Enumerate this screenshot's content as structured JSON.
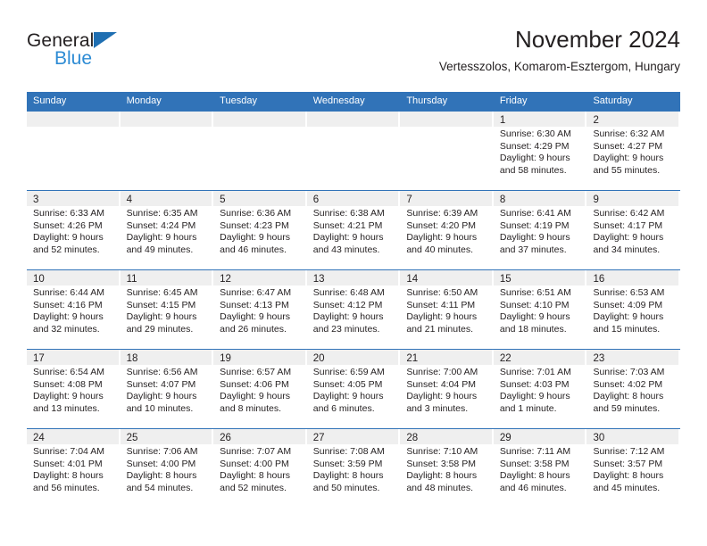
{
  "brand": {
    "name_top": "General",
    "name_bottom": "Blue",
    "triangle_color": "#1f6fb2",
    "blue_text_color": "#2d8bd4"
  },
  "header": {
    "title": "November 2024",
    "subtitle": "Vertesszolos, Komarom-Esztergom, Hungary"
  },
  "theme": {
    "header_blue": "#3173b8",
    "day_band_gray": "#efefef",
    "text_color": "#231f20"
  },
  "weekday_headers": [
    "Sunday",
    "Monday",
    "Tuesday",
    "Wednesday",
    "Thursday",
    "Friday",
    "Saturday"
  ],
  "weeks": [
    [
      {
        "day": "",
        "lines": []
      },
      {
        "day": "",
        "lines": []
      },
      {
        "day": "",
        "lines": []
      },
      {
        "day": "",
        "lines": []
      },
      {
        "day": "",
        "lines": []
      },
      {
        "day": "1",
        "lines": [
          "Sunrise: 6:30 AM",
          "Sunset: 4:29 PM",
          "Daylight: 9 hours",
          "and 58 minutes."
        ]
      },
      {
        "day": "2",
        "lines": [
          "Sunrise: 6:32 AM",
          "Sunset: 4:27 PM",
          "Daylight: 9 hours",
          "and 55 minutes."
        ]
      }
    ],
    [
      {
        "day": "3",
        "lines": [
          "Sunrise: 6:33 AM",
          "Sunset: 4:26 PM",
          "Daylight: 9 hours",
          "and 52 minutes."
        ]
      },
      {
        "day": "4",
        "lines": [
          "Sunrise: 6:35 AM",
          "Sunset: 4:24 PM",
          "Daylight: 9 hours",
          "and 49 minutes."
        ]
      },
      {
        "day": "5",
        "lines": [
          "Sunrise: 6:36 AM",
          "Sunset: 4:23 PM",
          "Daylight: 9 hours",
          "and 46 minutes."
        ]
      },
      {
        "day": "6",
        "lines": [
          "Sunrise: 6:38 AM",
          "Sunset: 4:21 PM",
          "Daylight: 9 hours",
          "and 43 minutes."
        ]
      },
      {
        "day": "7",
        "lines": [
          "Sunrise: 6:39 AM",
          "Sunset: 4:20 PM",
          "Daylight: 9 hours",
          "and 40 minutes."
        ]
      },
      {
        "day": "8",
        "lines": [
          "Sunrise: 6:41 AM",
          "Sunset: 4:19 PM",
          "Daylight: 9 hours",
          "and 37 minutes."
        ]
      },
      {
        "day": "9",
        "lines": [
          "Sunrise: 6:42 AM",
          "Sunset: 4:17 PM",
          "Daylight: 9 hours",
          "and 34 minutes."
        ]
      }
    ],
    [
      {
        "day": "10",
        "lines": [
          "Sunrise: 6:44 AM",
          "Sunset: 4:16 PM",
          "Daylight: 9 hours",
          "and 32 minutes."
        ]
      },
      {
        "day": "11",
        "lines": [
          "Sunrise: 6:45 AM",
          "Sunset: 4:15 PM",
          "Daylight: 9 hours",
          "and 29 minutes."
        ]
      },
      {
        "day": "12",
        "lines": [
          "Sunrise: 6:47 AM",
          "Sunset: 4:13 PM",
          "Daylight: 9 hours",
          "and 26 minutes."
        ]
      },
      {
        "day": "13",
        "lines": [
          "Sunrise: 6:48 AM",
          "Sunset: 4:12 PM",
          "Daylight: 9 hours",
          "and 23 minutes."
        ]
      },
      {
        "day": "14",
        "lines": [
          "Sunrise: 6:50 AM",
          "Sunset: 4:11 PM",
          "Daylight: 9 hours",
          "and 21 minutes."
        ]
      },
      {
        "day": "15",
        "lines": [
          "Sunrise: 6:51 AM",
          "Sunset: 4:10 PM",
          "Daylight: 9 hours",
          "and 18 minutes."
        ]
      },
      {
        "day": "16",
        "lines": [
          "Sunrise: 6:53 AM",
          "Sunset: 4:09 PM",
          "Daylight: 9 hours",
          "and 15 minutes."
        ]
      }
    ],
    [
      {
        "day": "17",
        "lines": [
          "Sunrise: 6:54 AM",
          "Sunset: 4:08 PM",
          "Daylight: 9 hours",
          "and 13 minutes."
        ]
      },
      {
        "day": "18",
        "lines": [
          "Sunrise: 6:56 AM",
          "Sunset: 4:07 PM",
          "Daylight: 9 hours",
          "and 10 minutes."
        ]
      },
      {
        "day": "19",
        "lines": [
          "Sunrise: 6:57 AM",
          "Sunset: 4:06 PM",
          "Daylight: 9 hours",
          "and 8 minutes."
        ]
      },
      {
        "day": "20",
        "lines": [
          "Sunrise: 6:59 AM",
          "Sunset: 4:05 PM",
          "Daylight: 9 hours",
          "and 6 minutes."
        ]
      },
      {
        "day": "21",
        "lines": [
          "Sunrise: 7:00 AM",
          "Sunset: 4:04 PM",
          "Daylight: 9 hours",
          "and 3 minutes."
        ]
      },
      {
        "day": "22",
        "lines": [
          "Sunrise: 7:01 AM",
          "Sunset: 4:03 PM",
          "Daylight: 9 hours",
          "and 1 minute."
        ]
      },
      {
        "day": "23",
        "lines": [
          "Sunrise: 7:03 AM",
          "Sunset: 4:02 PM",
          "Daylight: 8 hours",
          "and 59 minutes."
        ]
      }
    ],
    [
      {
        "day": "24",
        "lines": [
          "Sunrise: 7:04 AM",
          "Sunset: 4:01 PM",
          "Daylight: 8 hours",
          "and 56 minutes."
        ]
      },
      {
        "day": "25",
        "lines": [
          "Sunrise: 7:06 AM",
          "Sunset: 4:00 PM",
          "Daylight: 8 hours",
          "and 54 minutes."
        ]
      },
      {
        "day": "26",
        "lines": [
          "Sunrise: 7:07 AM",
          "Sunset: 4:00 PM",
          "Daylight: 8 hours",
          "and 52 minutes."
        ]
      },
      {
        "day": "27",
        "lines": [
          "Sunrise: 7:08 AM",
          "Sunset: 3:59 PM",
          "Daylight: 8 hours",
          "and 50 minutes."
        ]
      },
      {
        "day": "28",
        "lines": [
          "Sunrise: 7:10 AM",
          "Sunset: 3:58 PM",
          "Daylight: 8 hours",
          "and 48 minutes."
        ]
      },
      {
        "day": "29",
        "lines": [
          "Sunrise: 7:11 AM",
          "Sunset: 3:58 PM",
          "Daylight: 8 hours",
          "and 46 minutes."
        ]
      },
      {
        "day": "30",
        "lines": [
          "Sunrise: 7:12 AM",
          "Sunset: 3:57 PM",
          "Daylight: 8 hours",
          "and 45 minutes."
        ]
      }
    ]
  ]
}
